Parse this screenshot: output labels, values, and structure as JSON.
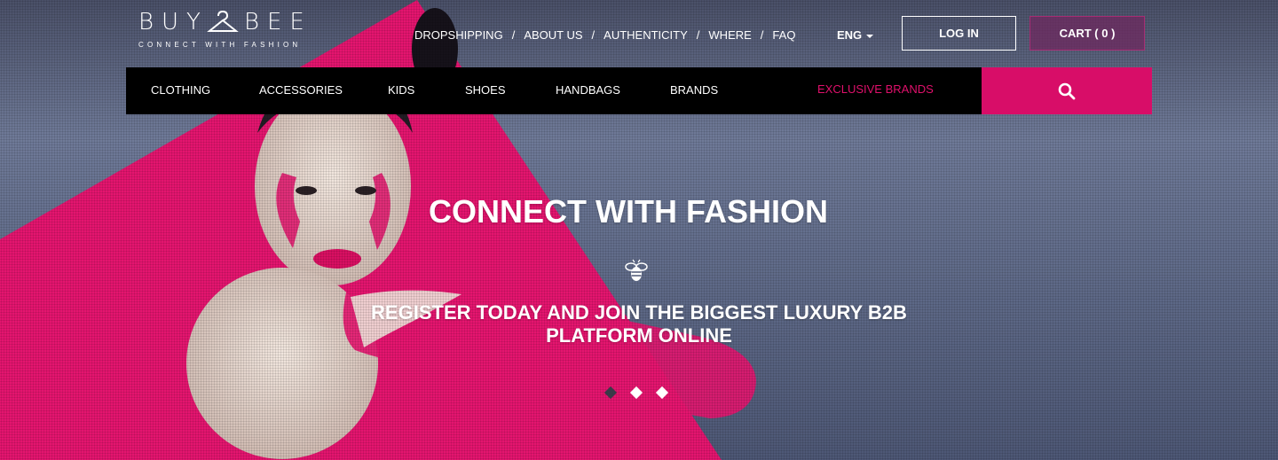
{
  "brand": {
    "logo_left": "BUY",
    "logo_right": "BEE",
    "tagline": "CONNECT WITH FASHION"
  },
  "top_links": [
    "DROPSHIPPING",
    "ABOUT US",
    "AUTHENTICITY",
    "WHERE",
    "FAQ"
  ],
  "language": "ENG",
  "login_label": "LOG IN",
  "cart_label": "CART ( 0 )",
  "nav": {
    "items": [
      "CLOTHING",
      "ACCESSORIES",
      "KIDS",
      "SHOES",
      "HANDBAGS",
      "BRANDS"
    ],
    "exclusive": "EXCLUSIVE BRANDS"
  },
  "hero": {
    "title": "CONNECT WITH FASHION",
    "subtitle": "REGISTER TODAY AND JOIN THE BIGGEST LUXURY B2B PLATFORM ONLINE",
    "slide_count": 3,
    "active_slide": 1
  },
  "colors": {
    "accent": "#d80d68",
    "nav_bg": "#000000",
    "cart_bg": "#6e285f"
  },
  "icons": {
    "search": "search-icon",
    "bee": "bee-icon",
    "hanger": "hanger-icon",
    "caret": "chevron-down-icon"
  }
}
